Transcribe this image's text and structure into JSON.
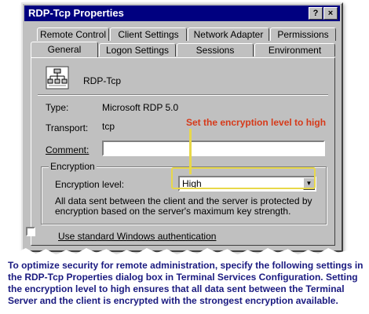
{
  "dialog": {
    "title": "RDP-Tcp Properties",
    "help_button": "?",
    "close_button": "×"
  },
  "tabs_back": [
    "Remote Control",
    "Client Settings",
    "Network Adapter",
    "Permissions"
  ],
  "tabs_front": [
    "General",
    "Logon Settings",
    "Sessions",
    "Environment"
  ],
  "active_tab": "General",
  "general": {
    "connection_name": "RDP-Tcp",
    "type_label": "Type:",
    "type_value": "Microsoft RDP 5.0",
    "transport_label": "Transport:",
    "transport_value": "tcp",
    "comment_label": "Comment:",
    "comment_value": "",
    "encryption_group": "Encryption",
    "encryption_level_label": "Encryption level:",
    "encryption_level_value": "High",
    "encryption_description": "All data sent between the client and the server is protected by encryption based on the server's maximum key strength.",
    "windows_auth_label": "Use standard Windows authentication",
    "windows_auth_checked": false
  },
  "callout": "Set the encryption level to high",
  "caption": "To optimize security for remote administration, specify the following settings in the RDP-Tcp Properties dialog box in Terminal Services Configuration. Setting the encryption level to high ensures that all data sent between the Terminal Server and the client is encrypted with the strongest encryption available.",
  "colors": {
    "titlebar": "#000080",
    "dialog": "#c0c0c0",
    "callout_text": "#d63a1a",
    "callout_highlight": "#e8d84a",
    "caption_text": "#1a1a80"
  }
}
